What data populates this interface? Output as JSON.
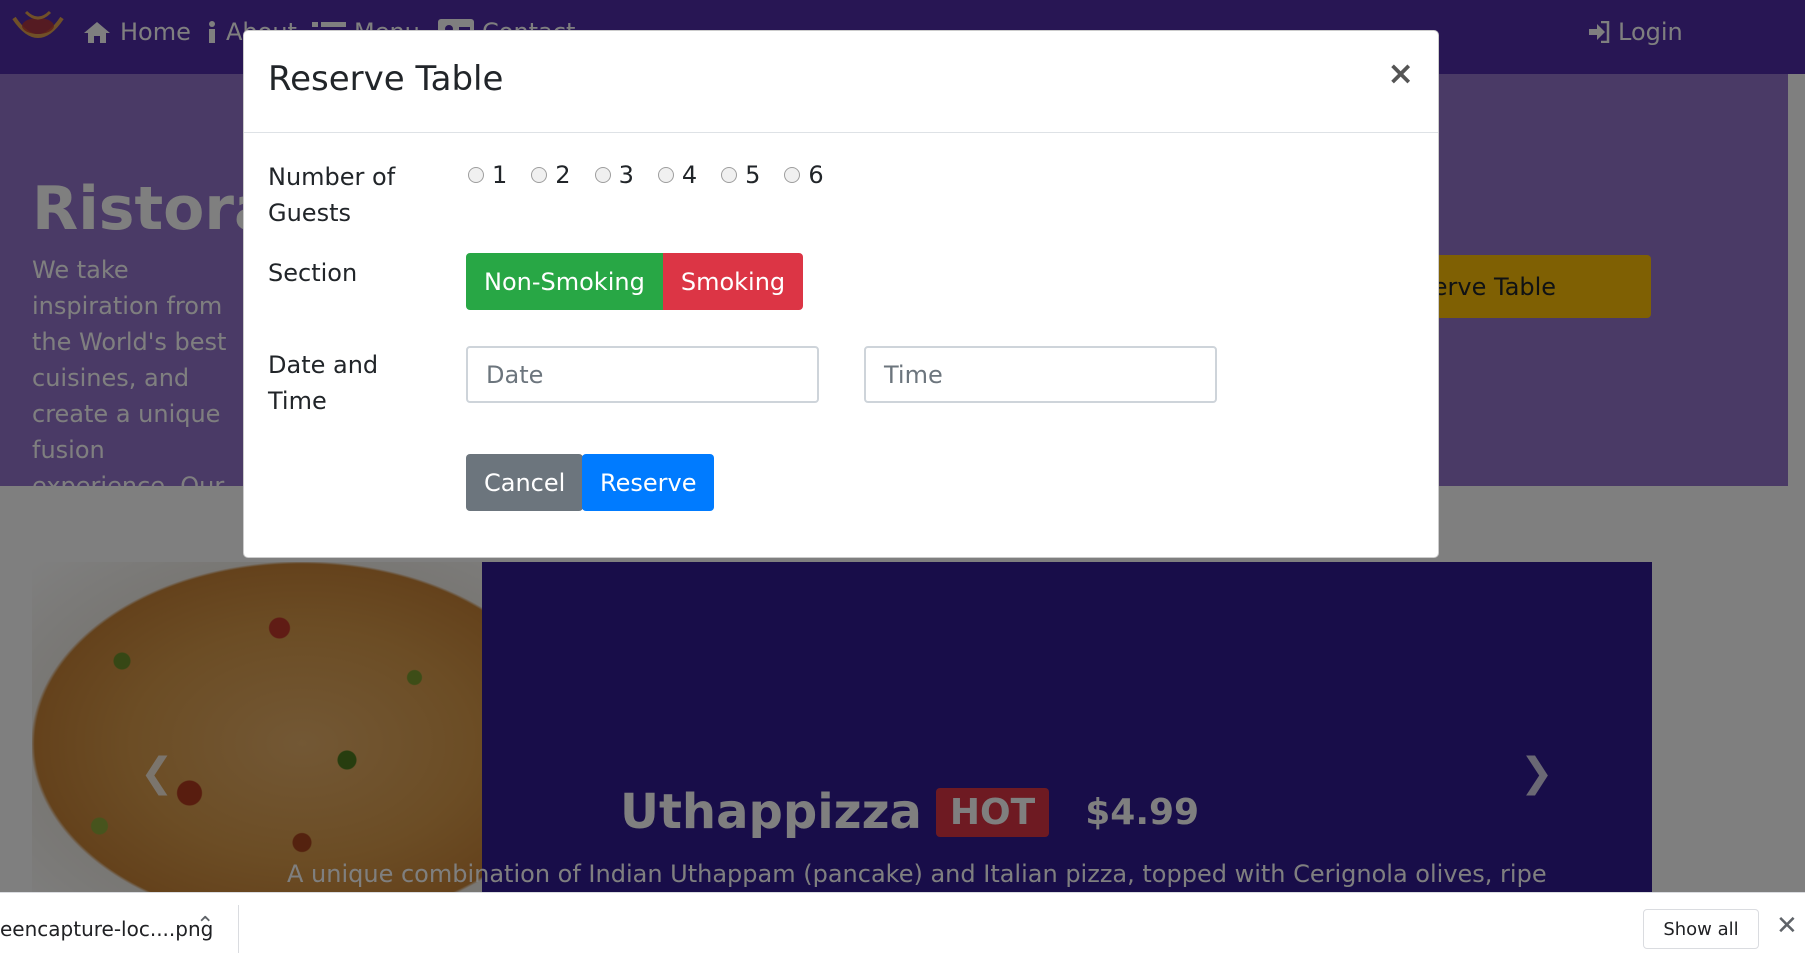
{
  "navbar": {
    "home": "Home",
    "about": "About",
    "menu": "Menu",
    "contact": "Contact",
    "login": "Login"
  },
  "jumbotron": {
    "title": "Ristorante Con Fusion",
    "text": "We take inspiration from the World's best cuisines, and create a unique fusion experience. Our lipsmacking creations will tickle your culinary senses!",
    "reserve_button": "Reserve Table"
  },
  "carousel": {
    "dish_name": "Uthappizza",
    "badge": "HOT",
    "price": "$4.99",
    "description": "A unique combination of Indian Uthappam (pancake) and Italian pizza, topped with Cerignola olives, ripe"
  },
  "modal": {
    "title": "Reserve Table",
    "close": "×",
    "guests_label": "Number of Guests",
    "guest_options": [
      "1",
      "2",
      "3",
      "4",
      "5",
      "6"
    ],
    "section_label": "Section",
    "section_options": [
      "Non-Smoking",
      "Smoking"
    ],
    "datetime_label": "Date and Time",
    "date_placeholder": "Date",
    "time_placeholder": "Time",
    "cancel": "Cancel",
    "reserve": "Reserve"
  },
  "download_bar": {
    "file_name": "eencapture-loc....png",
    "show_all": "Show all"
  },
  "colors": {
    "primary": "#512da8",
    "light": "#9575cd",
    "dark": "#311b92",
    "success": "#28a745",
    "danger": "#dc3545",
    "accent": "#007bff",
    "warning": "#ffc107"
  }
}
